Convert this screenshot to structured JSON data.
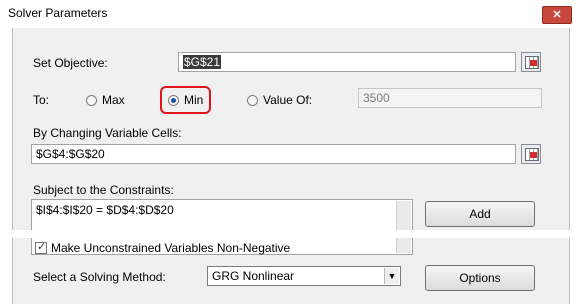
{
  "window": {
    "title": "Solver Parameters",
    "close_glyph": "✕"
  },
  "objective": {
    "label": "Set Objective:",
    "value": "$G$21"
  },
  "to": {
    "label": "To:",
    "options": [
      {
        "label": "Max",
        "checked": false
      },
      {
        "label": "Min",
        "checked": true
      },
      {
        "label": "Value Of:",
        "checked": false
      }
    ],
    "value_of": "3500"
  },
  "changing": {
    "label": "By Changing Variable Cells:",
    "value": "$G$4:$G$20"
  },
  "constraints": {
    "label": "Subject to the Constraints:",
    "items": [
      "$I$4:$I$20 = $D$4:$D$20"
    ],
    "add_label": "Add"
  },
  "nonneg": {
    "label": "Make Unconstrained Variables Non-Negative",
    "checked": true
  },
  "method": {
    "label": "Select a Solving Method:",
    "value": "GRG Nonlinear",
    "drop_glyph": "▼"
  },
  "options_button": "Options",
  "colors": {
    "highlight": "#e0151b",
    "close": "#c9483e"
  }
}
